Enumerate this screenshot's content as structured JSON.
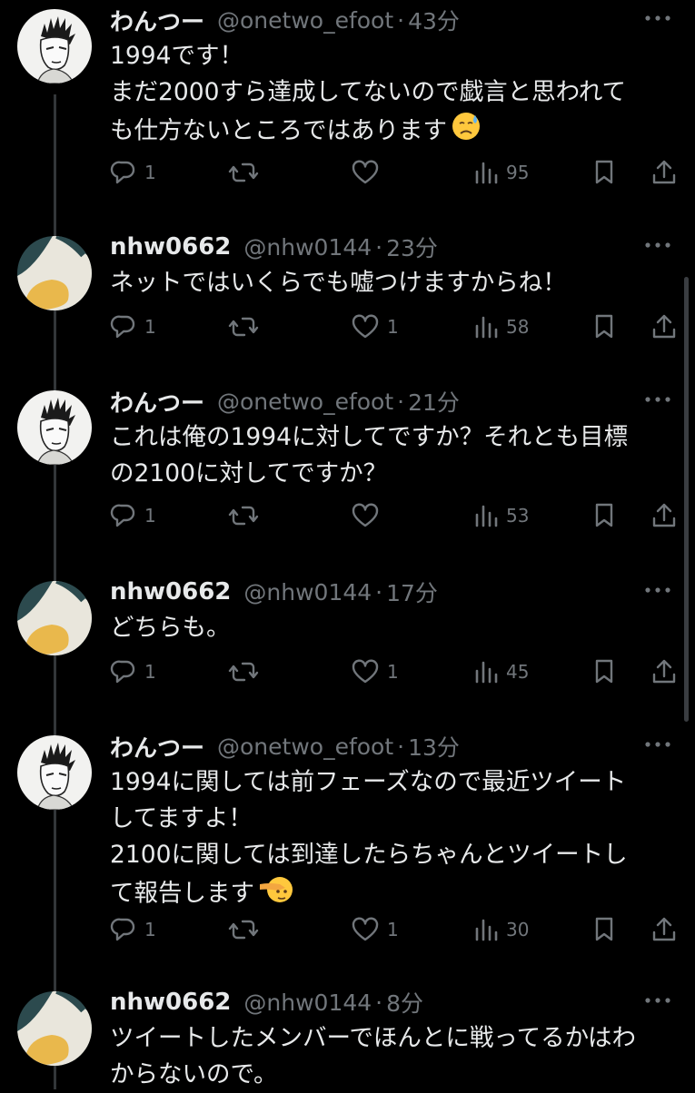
{
  "tweets": [
    {
      "name": "わんつー",
      "handle": "@onetwo_efoot",
      "time": "43分",
      "lines": [
        "1994です！",
        "まだ2000すら達成してないので戯言と思われて",
        "も仕方ないところではあります"
      ],
      "emoji": "sad-sweat-face-icon",
      "replies": "1",
      "retweets": "",
      "likes": "",
      "views": "95"
    },
    {
      "name": "nhw0662",
      "handle": "@nhw0144",
      "time": "23分",
      "lines": [
        "ネットではいくらでも嘘つけますからね！"
      ],
      "replies": "1",
      "retweets": "",
      "likes": "1",
      "views": "58"
    },
    {
      "name": "わんつー",
      "handle": "@onetwo_efoot",
      "time": "21分",
      "lines": [
        "これは俺の1994に対してですか？それとも目標",
        "の2100に対してですか？"
      ],
      "replies": "1",
      "retweets": "",
      "likes": "",
      "views": "53"
    },
    {
      "name": "nhw0662",
      "handle": "@nhw0144",
      "time": "17分",
      "lines": [
        "どちらも。"
      ],
      "replies": "1",
      "retweets": "",
      "likes": "1",
      "views": "45"
    },
    {
      "name": "わんつー",
      "handle": "@onetwo_efoot",
      "time": "13分",
      "lines": [
        "1994に関しては前フェーズなので最近ツイート",
        "してますよ！",
        "2100に関しては到達したらちゃんとツイートし",
        "て報告します"
      ],
      "emoji": "saluting-face-icon",
      "replies": "1",
      "retweets": "",
      "likes": "1",
      "views": "30"
    },
    {
      "name": "nhw0662",
      "handle": "@nhw0144",
      "time": "8分",
      "lines": [
        "ツイートしたメンバーでほんとに戦ってるかはわ",
        "からないので。"
      ]
    }
  ],
  "colors": {
    "background": "#000000",
    "text": "#e7e9ea",
    "muted": "#71767b",
    "thread_line": "#333639"
  }
}
